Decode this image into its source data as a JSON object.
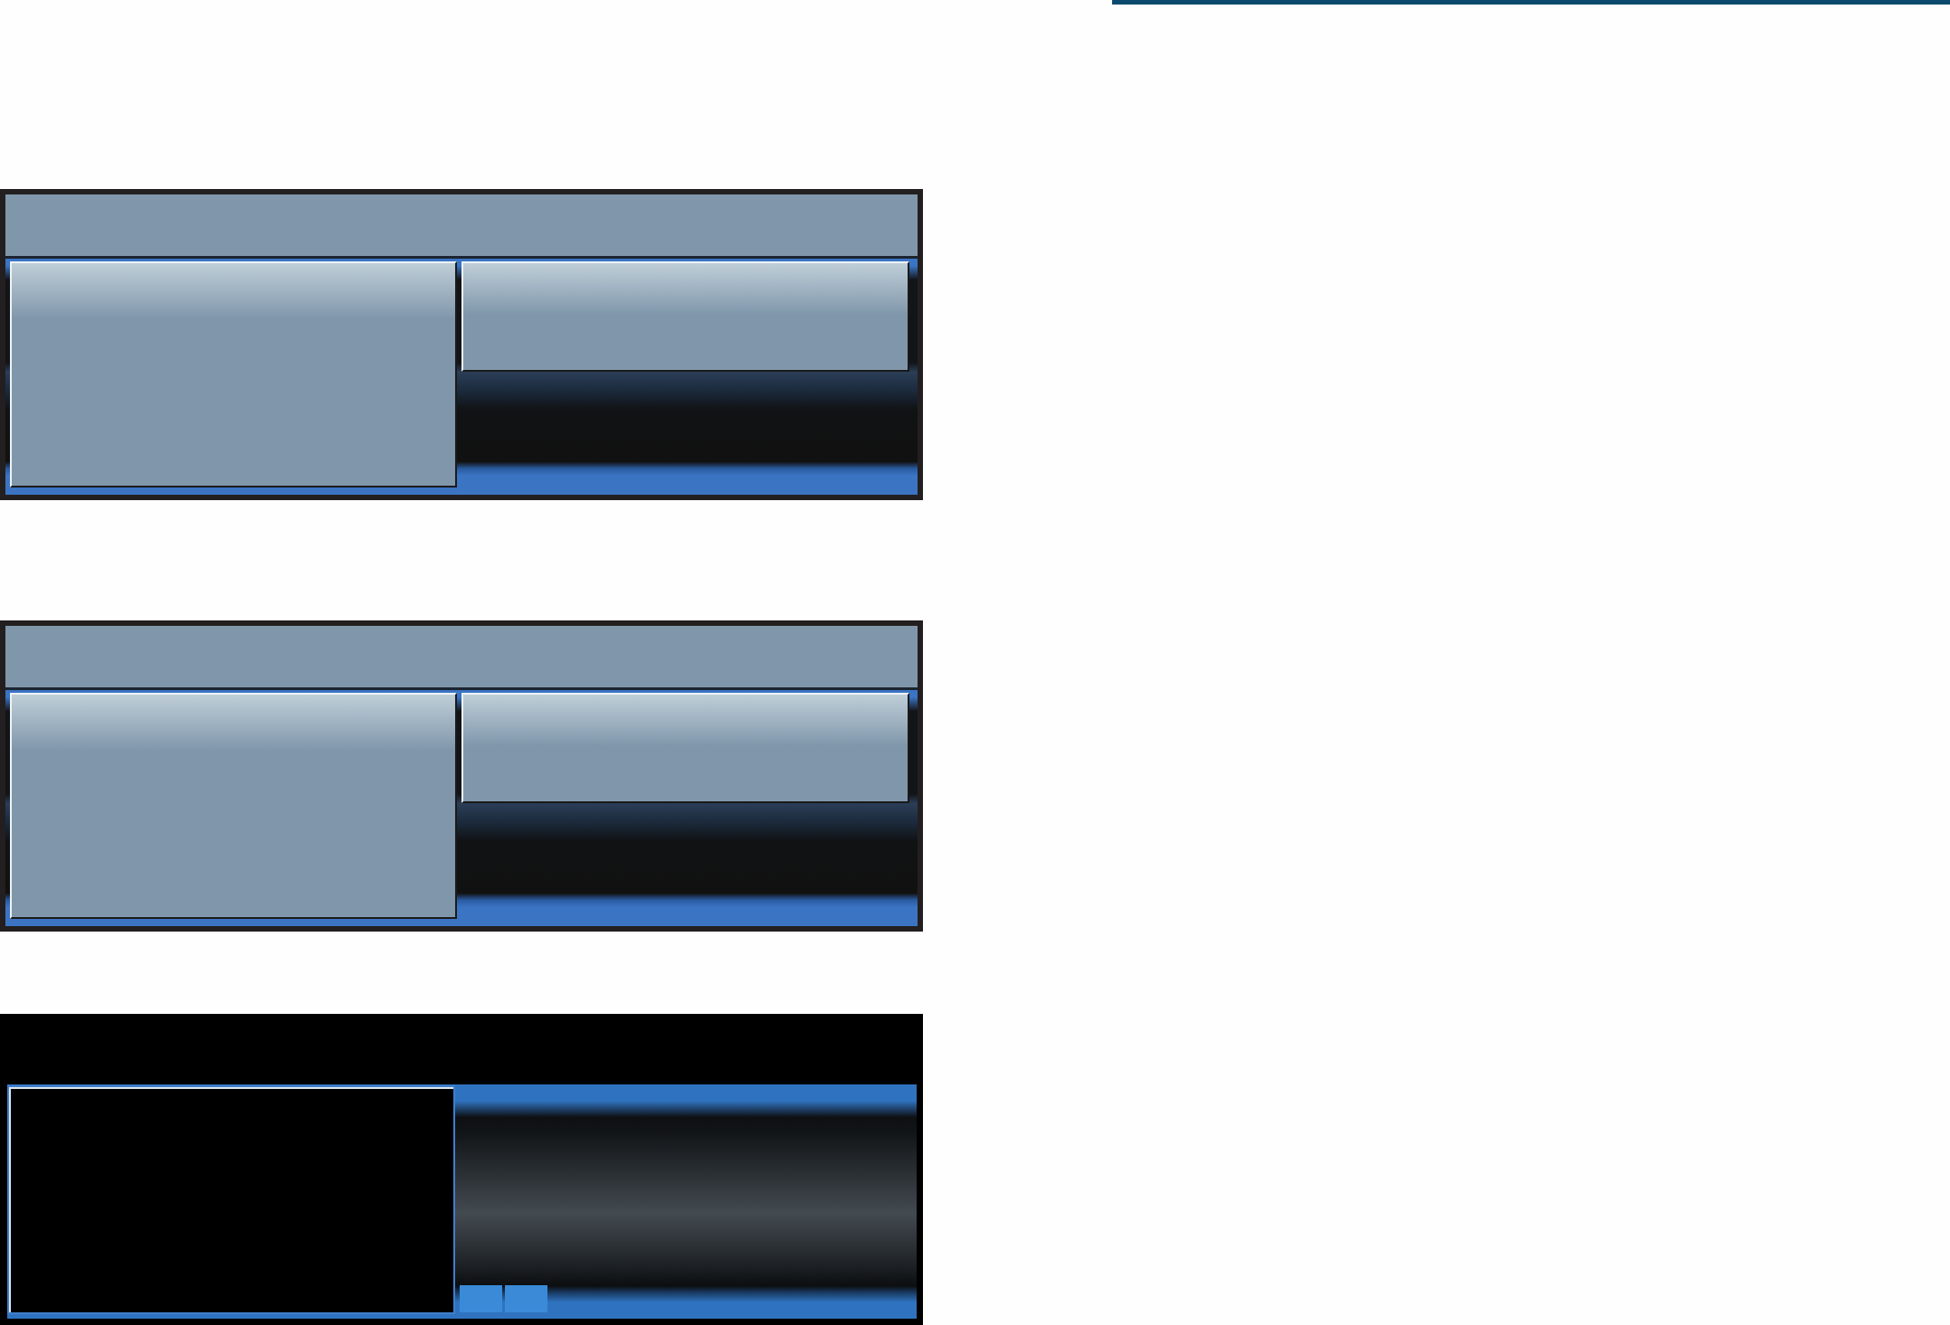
{
  "screens": [
    {
      "kind": "light"
    },
    {
      "kind": "light"
    },
    {
      "kind": "dark"
    }
  ]
}
